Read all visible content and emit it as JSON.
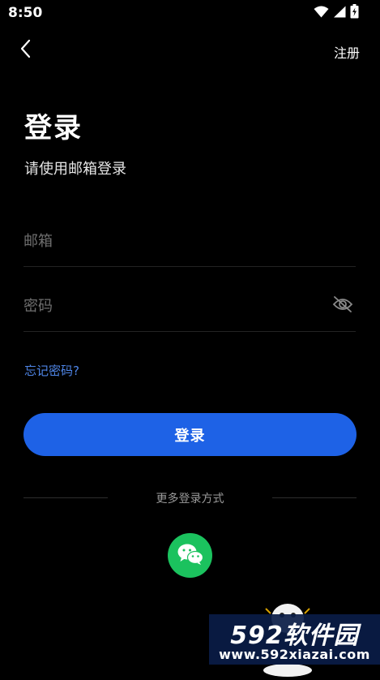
{
  "status_bar": {
    "time": "8:50",
    "icons": [
      "wifi-icon",
      "signal-icon",
      "battery-icon"
    ]
  },
  "header": {
    "back_icon": "chevron-left-icon",
    "register_label": "注册"
  },
  "main": {
    "title": "登录",
    "subtitle": "请使用邮箱登录",
    "email_placeholder": "邮箱",
    "email_value": "",
    "password_placeholder": "密码",
    "password_value": "",
    "password_toggle_icon": "eye-off-icon",
    "forgot_label": "忘记密码?",
    "login_button_label": "登录",
    "more_login_label": "更多登录方式",
    "wechat_icon": "wechat-icon"
  },
  "watermark": {
    "brand": "592软件园",
    "url": "www.592xiazai.com"
  },
  "colors": {
    "background": "#000000",
    "primary": "#1e62e6",
    "link": "#4f86e8",
    "wechat": "#1bc25e"
  }
}
